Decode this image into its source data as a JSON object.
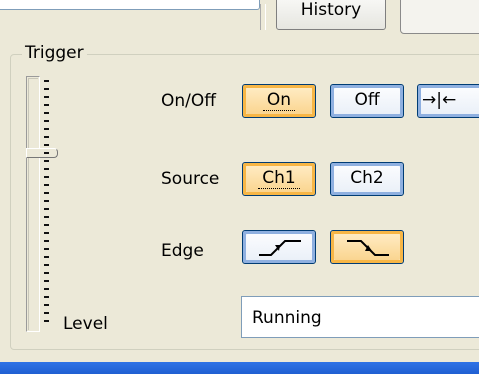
{
  "header": {
    "history_label": "History"
  },
  "trigger": {
    "group_title": "Trigger",
    "level_label": "Level",
    "onoff": {
      "label": "On/Off",
      "buttons": [
        "On",
        "Off"
      ],
      "selected": "On",
      "extra_button_icon": "arrows-collapse-icon",
      "extra_button_text": "→|←"
    },
    "source": {
      "label": "Source",
      "buttons": [
        "Ch1",
        "Ch2"
      ],
      "selected": "Ch1"
    },
    "edge": {
      "label": "Edge",
      "buttons": [
        "rising-edge-icon",
        "falling-edge-icon"
      ],
      "selected": "falling-edge-icon"
    },
    "status": "Running"
  },
  "colors": {
    "background": "#ece9d8",
    "selected_button": "#fad590",
    "unselected_button": "#eaf0f8",
    "title_bar": "#1f5fd2"
  }
}
